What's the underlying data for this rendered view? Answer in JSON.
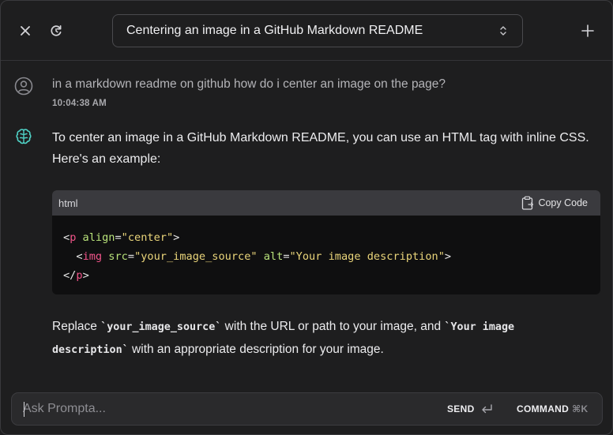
{
  "header": {
    "close_icon": "close-icon",
    "history_icon": "refresh-icon",
    "conversation_title": "Centering an image in a GitHub Markdown README",
    "new_icon": "plus-icon"
  },
  "user_message": {
    "text": "in a markdown readme on github how do i center an image on the page?",
    "timestamp": "10:04:38 AM"
  },
  "assistant_message": {
    "intro_line1": "To center an image in a GitHub Markdown README, you can use an HTML tag with inline CSS.",
    "intro_line2": "Here's an example:",
    "code": {
      "language": "html",
      "copy_label": "Copy Code",
      "line1": {
        "open": "<",
        "tag": "p",
        "attr": " align",
        "eq": "=",
        "val": "\"center\"",
        "close": ">"
      },
      "line2": {
        "indent": "  ",
        "open": "<",
        "tag": "img",
        "attr1": " src",
        "eq1": "=",
        "val1": "\"your_image_source\"",
        "attr2": " alt",
        "eq2": "=",
        "val2": "\"Your image description\"",
        "close": ">"
      },
      "line3": {
        "open": "</",
        "tag": "p",
        "close": ">"
      }
    },
    "outro": {
      "t1": "Replace ",
      "code1": "`your_image_source`",
      "t2": " with the URL or path to your image, and ",
      "code2a": "`Your image",
      "code2b": "description`",
      "t3": " with an appropriate description for your image."
    }
  },
  "input": {
    "placeholder": "Ask Prompta...",
    "value": "",
    "send_label": "SEND",
    "command_label": "COMMAND",
    "command_shortcut": "⌘K"
  },
  "colors": {
    "background": "#1e1e1f",
    "accent_bot_icon": "#4fd1c5",
    "code_tag": "#f2558a",
    "code_attr": "#b8e27a",
    "code_string": "#ead57a"
  }
}
